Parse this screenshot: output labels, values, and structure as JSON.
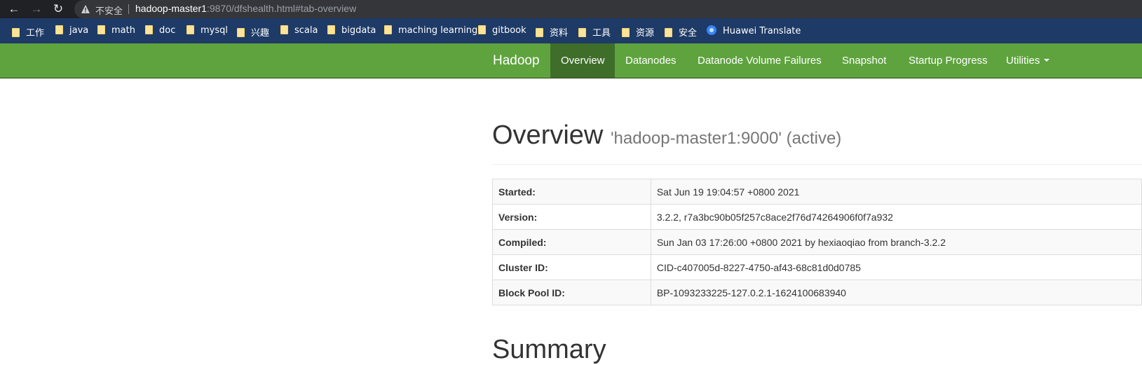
{
  "browser": {
    "security_label": "不安全",
    "url_host": "hadoop-master1",
    "url_rest": ":9870/dfshealth.html#tab-overview"
  },
  "bookmarks": [
    {
      "label": "工作",
      "icon": "folder-icon"
    },
    {
      "label": "java",
      "icon": "folder-icon"
    },
    {
      "label": "math",
      "icon": "folder-icon"
    },
    {
      "label": "doc",
      "icon": "folder-icon"
    },
    {
      "label": "mysql",
      "icon": "folder-icon"
    },
    {
      "label": "兴趣",
      "icon": "folder-icon"
    },
    {
      "label": "scala",
      "icon": "folder-icon"
    },
    {
      "label": "bigdata",
      "icon": "folder-icon"
    },
    {
      "label": "maching learning",
      "icon": "folder-icon"
    },
    {
      "label": "gitbook",
      "icon": "folder-icon"
    },
    {
      "label": "资料",
      "icon": "folder-icon"
    },
    {
      "label": "工具",
      "icon": "folder-icon"
    },
    {
      "label": "资源",
      "icon": "folder-icon"
    },
    {
      "label": "安全",
      "icon": "folder-icon"
    },
    {
      "label": "Huawei Translate",
      "icon": "translate-icon"
    }
  ],
  "navbar": {
    "brand": "Hadoop",
    "items": [
      "Overview",
      "Datanodes",
      "Datanode Volume Failures",
      "Snapshot",
      "Startup Progress",
      "Utilities"
    ],
    "active": "Overview",
    "color": "#5fa33e",
    "active_color": "#3e6e2a"
  },
  "overview": {
    "title": "Overview",
    "subtitle": "'hadoop-master1:9000' (active)",
    "rows": [
      {
        "key": "Started:",
        "value": "Sat Jun 19 19:04:57 +0800 2021"
      },
      {
        "key": "Version:",
        "value": "3.2.2, r7a3bc90b05f257c8ace2f76d74264906f0f7a932"
      },
      {
        "key": "Compiled:",
        "value": "Sun Jan 03 17:26:00 +0800 2021 by hexiaoqiao from branch-3.2.2"
      },
      {
        "key": "Cluster ID:",
        "value": "CID-c407005d-8227-4750-af43-68c81d0d0785"
      },
      {
        "key": "Block Pool ID:",
        "value": "BP-1093233225-127.0.2.1-1624100683940"
      }
    ]
  },
  "summary": {
    "title": "Summary"
  }
}
